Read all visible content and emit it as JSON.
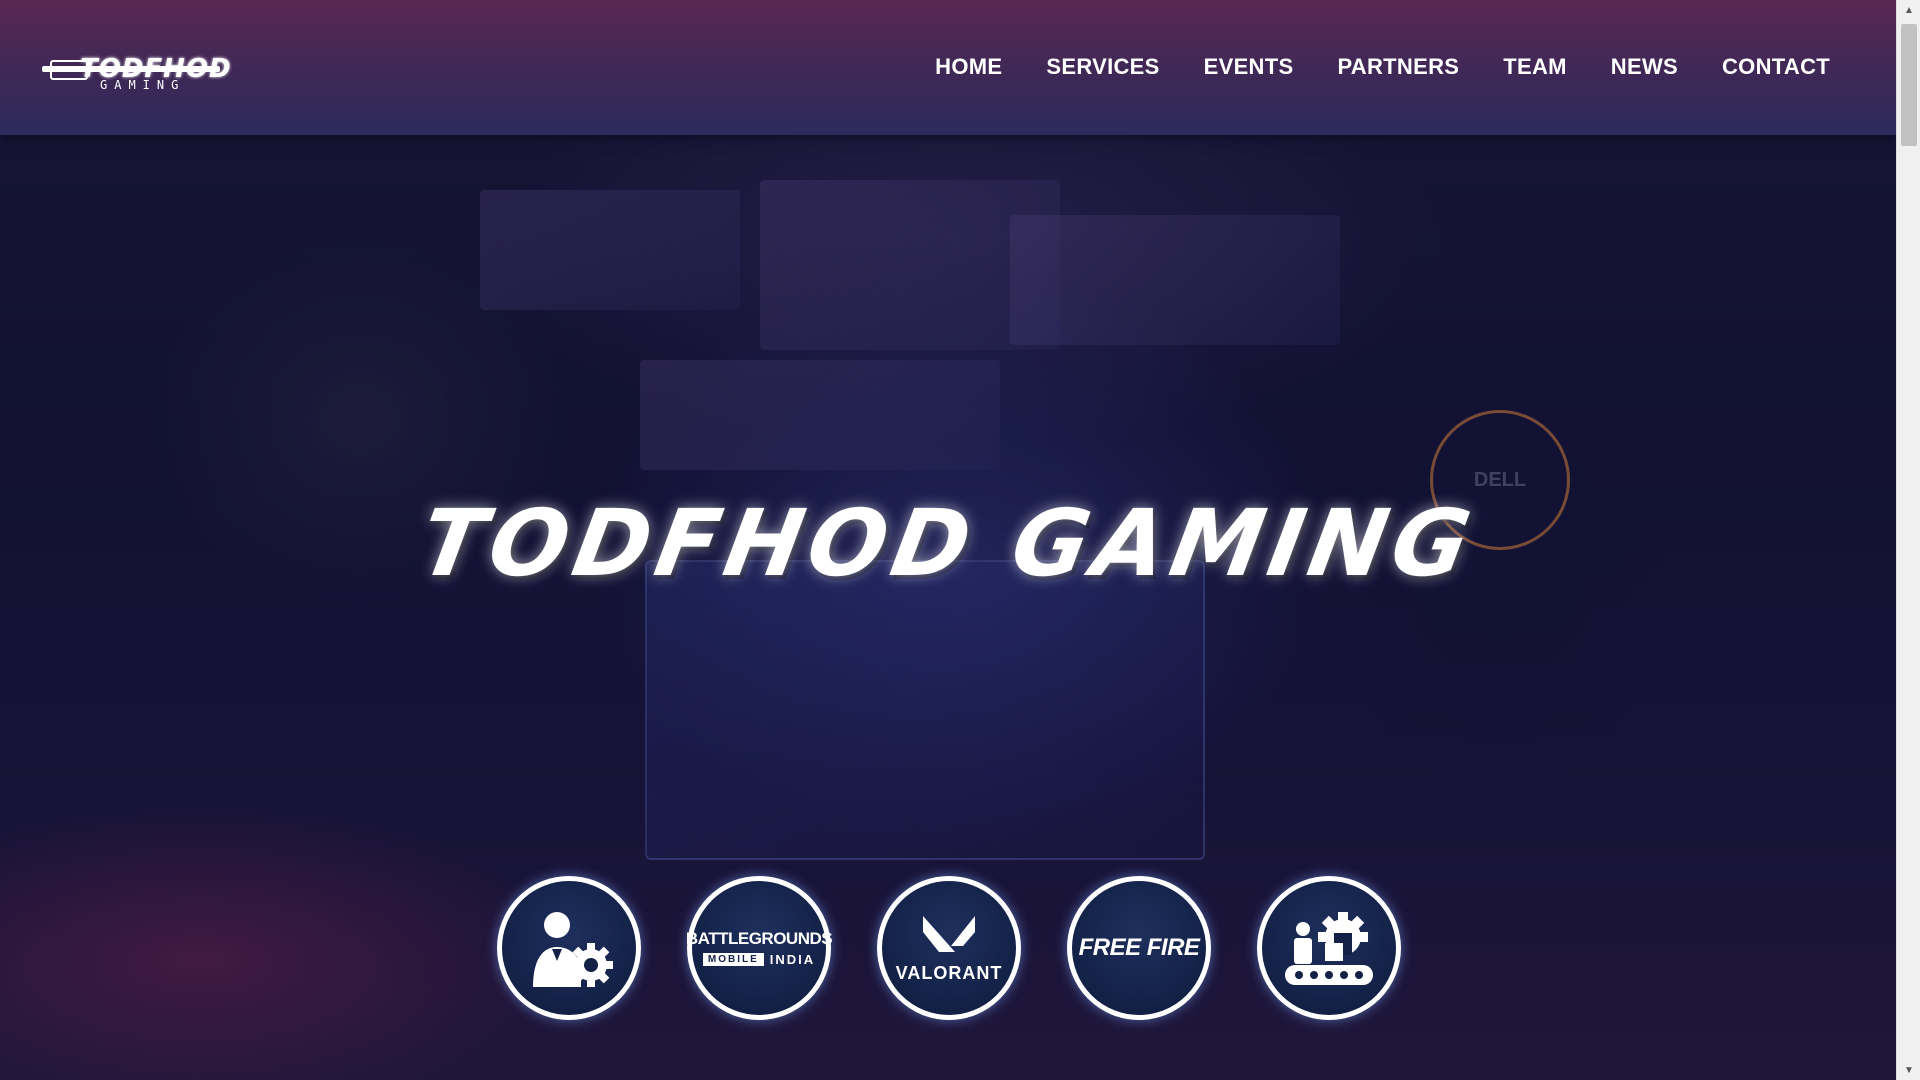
{
  "brand": {
    "logo_text": "TODFHOD",
    "logo_sub": "GAMING"
  },
  "nav": {
    "items": [
      {
        "label": "HOME"
      },
      {
        "label": "SERVICES"
      },
      {
        "label": "EVENTS"
      },
      {
        "label": "PARTNERS"
      },
      {
        "label": "TEAM"
      },
      {
        "label": "NEWS"
      },
      {
        "label": "CONTACT"
      }
    ]
  },
  "hero": {
    "title": "TODFHOD GAMING",
    "background_text": "DELL"
  },
  "icons": {
    "pubg_line1": "BATTLEGROUNDS",
    "pubg_mobile": "MOBILE",
    "pubg_india": "INDIA",
    "valorant": "VALORANT",
    "freefire": "FREE FIRE"
  },
  "colors": {
    "nav_top": "#5a2752",
    "nav_bottom": "#2c2a5c",
    "icon_bg": "#132147",
    "text": "#ffffff"
  }
}
